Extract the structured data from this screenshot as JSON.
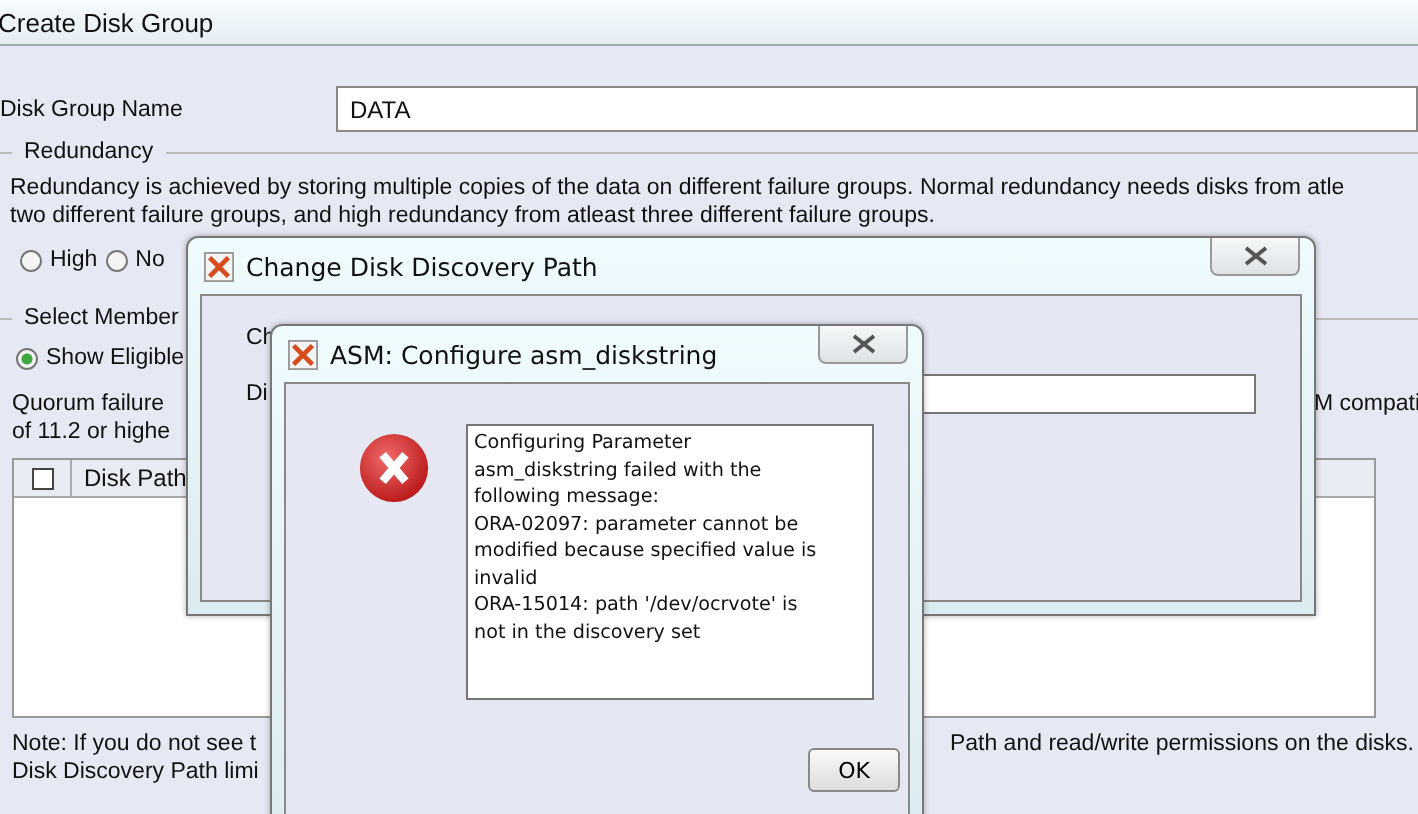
{
  "window": {
    "title": "Create Disk Group"
  },
  "disk_group_name": {
    "label": "Disk Group Name",
    "value": "DATA"
  },
  "redundancy": {
    "legend": "Redundancy",
    "description": [
      "Redundancy is achieved by storing multiple copies of the data on different failure groups. Normal redundancy needs disks from atle",
      "two different failure groups, and high redundancy from atleast three different failure groups."
    ],
    "options": [
      {
        "label": "High",
        "selected": false
      },
      {
        "label": "No",
        "selected": false
      }
    ]
  },
  "select_member": {
    "legend": "Select Member",
    "options": [
      {
        "label": "Show Eligible",
        "selected": true
      }
    ],
    "quorum_text": [
      "Quorum failure",
      "of 11.2 or highe"
    ],
    "compat_text": "M compati",
    "table": {
      "header_checked": false,
      "columns": [
        "Disk Path"
      ]
    }
  },
  "note": {
    "lines": [
      "Note: If you do not see t",
      "Disk Discovery Path limi"
    ],
    "tail": "Path and read/write permissions on the disks."
  },
  "discovery_dialog": {
    "title": "Change Disk Discovery Path",
    "labels": [
      "Ch",
      "Di"
    ]
  },
  "error_dialog": {
    "title": "ASM: Configure asm_diskstring",
    "message": "Configuring Parameter\nasm_diskstring failed with the\nfollowing message:\nORA-02097: parameter cannot be\nmodified because specified value is\ninvalid\nORA-15014: path '/dev/ocrvote' is\nnot in the discovery set",
    "buttons": [
      "OK"
    ]
  }
}
